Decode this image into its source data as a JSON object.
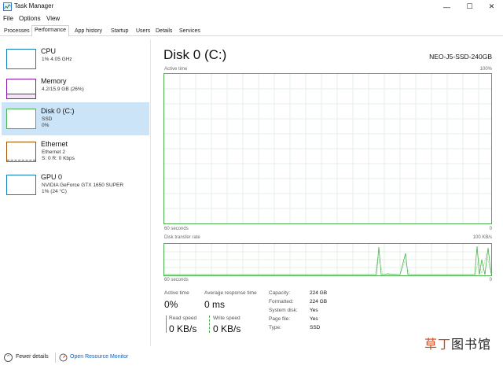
{
  "window": {
    "title": "Task Manager",
    "controls": [
      "—",
      "☐",
      "✕"
    ]
  },
  "menu": [
    "File",
    "Options",
    "View"
  ],
  "tabs": [
    "Processes",
    "Performance",
    "App history",
    "Startup",
    "Users",
    "Details",
    "Services"
  ],
  "sidebar": {
    "items": [
      {
        "name": "CPU",
        "line1": "1% 4.05 GHz",
        "line2": ""
      },
      {
        "name": "Memory",
        "line1": "4.2/15.9 GB (26%)",
        "line2": ""
      },
      {
        "name": "Disk 0 (C:)",
        "line1": "SSD",
        "line2": "0%"
      },
      {
        "name": "Ethernet",
        "line1": "Ethernet 2",
        "line2": "S: 0 R: 0 Kbps"
      },
      {
        "name": "GPU 0",
        "line1": "NVIDIA GeForce GTX 1650 SUPER",
        "line2": "1% (24 °C)"
      }
    ]
  },
  "main": {
    "title": "Disk 0 (C:)",
    "model": "NEO-J5-SSD-240GB",
    "graph1": {
      "label": "Active time",
      "max": "100%",
      "time": "60 seconds",
      "min": "0"
    },
    "graph2": {
      "label": "Disk transfer rate",
      "max": "100 KB/s",
      "time": "60 seconds",
      "min": "0"
    },
    "stats": {
      "active_label": "Active time",
      "active_value": "0%",
      "resp_label": "Average response time",
      "resp_value": "0 ms",
      "read_label": "Read speed",
      "read_value": "0 KB/s",
      "write_label": "Write speed",
      "write_value": "0 KB/s"
    },
    "info": [
      {
        "key": "Capacity:",
        "val": "224 GB"
      },
      {
        "key": "Formatted:",
        "val": "224 GB"
      },
      {
        "key": "System disk:",
        "val": "Yes"
      },
      {
        "key": "Page file:",
        "val": "Yes"
      },
      {
        "key": "Type:",
        "val": "SSD"
      }
    ]
  },
  "footer": {
    "fewer": "Fewer details",
    "monitor": "Open Resource Monitor"
  },
  "watermark": {
    "a": "草",
    "b": "丁",
    "c": "图书馆"
  },
  "colors": {
    "disk": "#4caf50",
    "cpu": "#117dbb",
    "memory": "#8b12ae",
    "ethernet": "#a74f01",
    "selected": "#cce4f7",
    "link": "#0b61c4"
  }
}
